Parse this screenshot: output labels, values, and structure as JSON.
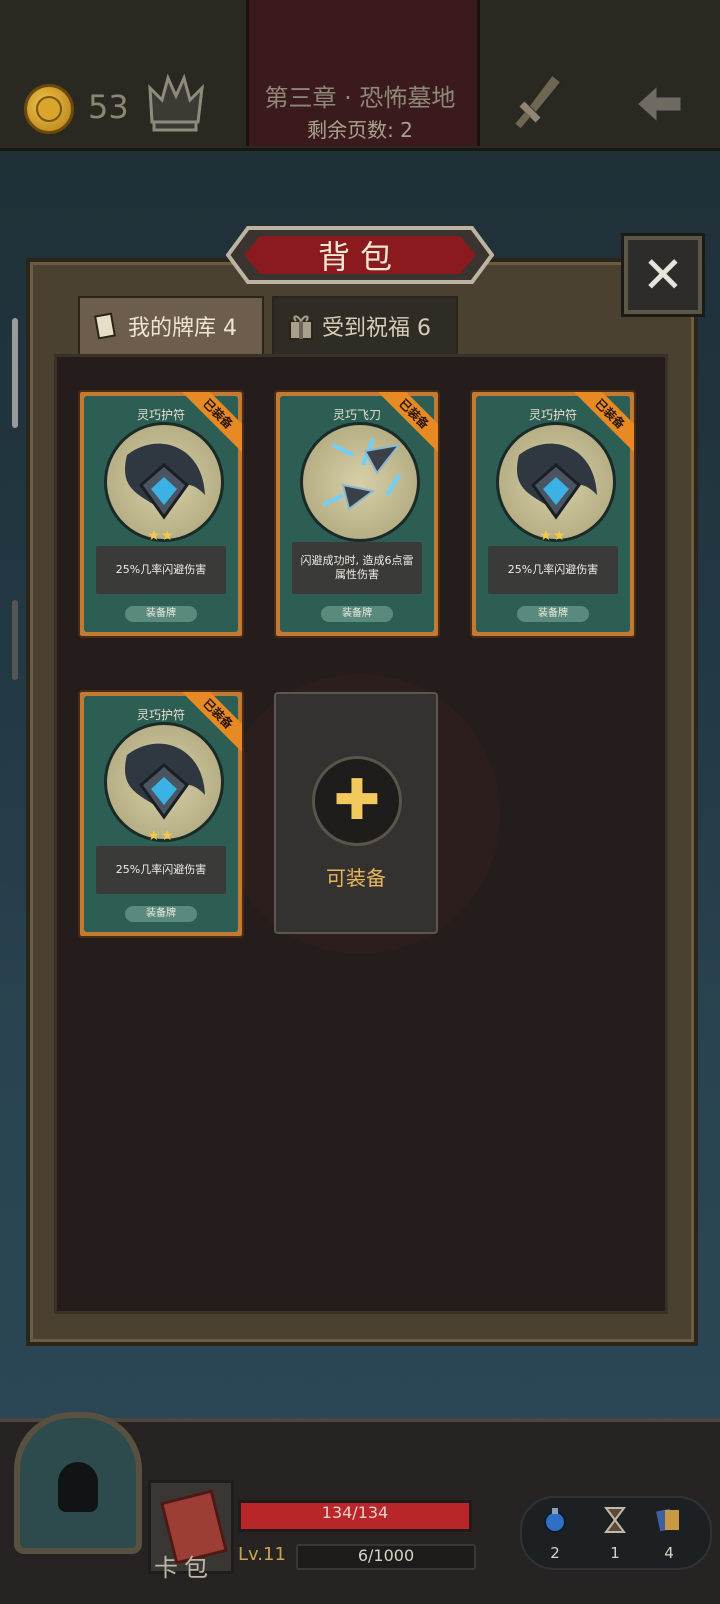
{
  "header": {
    "gold": "53",
    "chapter_title": "第三章 · 恐怖墓地",
    "pages_left": "剩余页数: 2"
  },
  "bag": {
    "title": "背包",
    "tabs": [
      {
        "label": "我的牌库 4"
      },
      {
        "label": "受到祝福 6"
      }
    ]
  },
  "cards": [
    {
      "name": "灵巧护符",
      "stars": "★★",
      "desc": "25%几率闪避伤害",
      "type": "装备牌",
      "ribbon": "已装备"
    },
    {
      "name": "灵巧飞刀",
      "stars": "",
      "desc": "闪避成功时, 造成6点雷属性伤害",
      "type": "装备牌",
      "ribbon": "已装备"
    },
    {
      "name": "灵巧护符",
      "stars": "★★",
      "desc": "25%几率闪避伤害",
      "type": "装备牌",
      "ribbon": "已装备"
    },
    {
      "name": "灵巧护符",
      "stars": "★★",
      "desc": "25%几率闪避伤害",
      "type": "装备牌",
      "ribbon": "已装备"
    }
  ],
  "equip_slot": {
    "label": "可装备"
  },
  "hud": {
    "bag_label": "卡包",
    "hp": "134/134",
    "level": "Lv.11",
    "xp": "6/1000",
    "resources": [
      {
        "icon": "potion-icon",
        "count": "2"
      },
      {
        "icon": "hourglass-icon",
        "count": "1"
      },
      {
        "icon": "cards-icon",
        "count": "4"
      }
    ]
  }
}
